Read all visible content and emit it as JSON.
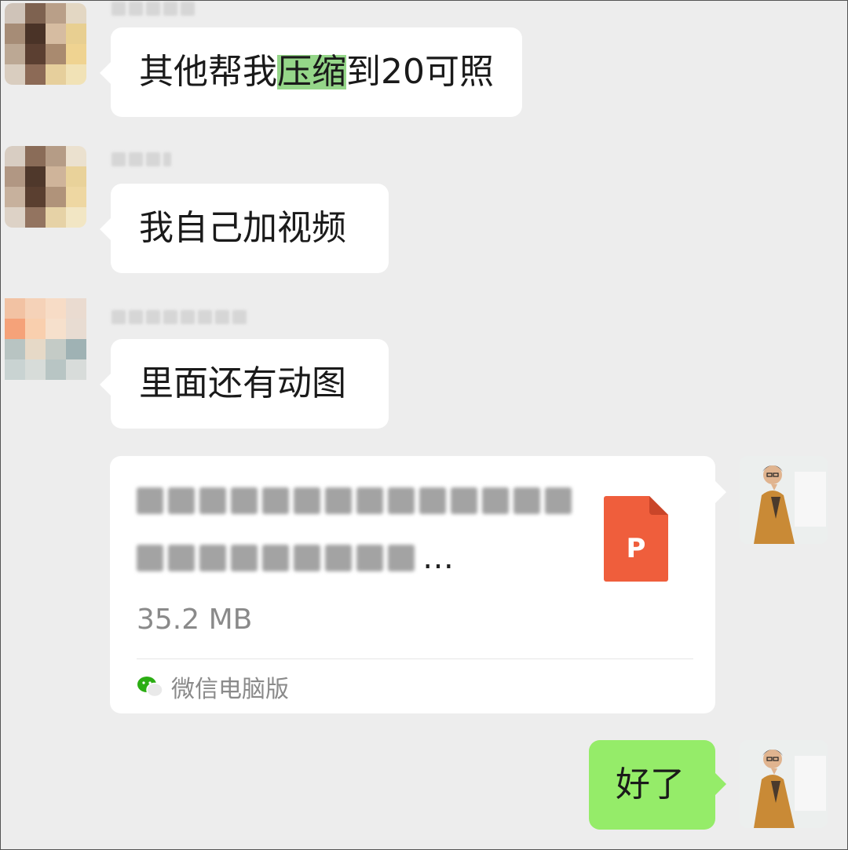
{
  "messages": [
    {
      "from": "other",
      "name_blurred": true,
      "text_parts": [
        "其他帮我",
        "压缩",
        "到20可照"
      ]
    },
    {
      "from": "other",
      "name_blurred": true,
      "text": "我自己加视频"
    },
    {
      "from": "other",
      "name_blurred": true,
      "text": "里面还有动图"
    },
    {
      "from": "self",
      "type": "file",
      "file": {
        "name_blurred": true,
        "name_suffix": "…",
        "size": "35.2 MB",
        "icon": "ppt-file-icon",
        "icon_letter": "P",
        "source": "微信电脑版",
        "source_icon": "wechat-icon"
      }
    },
    {
      "from": "self",
      "text": "好了"
    }
  ],
  "colors": {
    "background": "#ededed",
    "bubble_other": "#ffffff",
    "bubble_self": "#95ec69",
    "highlight": "#95d689",
    "ppt": "#ef5e3c",
    "wechat": "#2bad13"
  }
}
